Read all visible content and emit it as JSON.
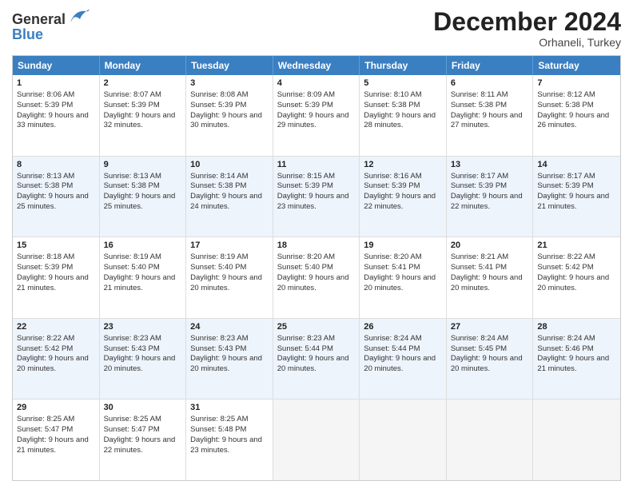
{
  "header": {
    "logo_line1": "General",
    "logo_line2": "Blue",
    "month": "December 2024",
    "location": "Orhaneli, Turkey"
  },
  "days": [
    "Sunday",
    "Monday",
    "Tuesday",
    "Wednesday",
    "Thursday",
    "Friday",
    "Saturday"
  ],
  "weeks": [
    [
      {
        "num": "1",
        "sunrise": "8:06 AM",
        "sunset": "5:39 PM",
        "daylight": "9 hours and 33 minutes."
      },
      {
        "num": "2",
        "sunrise": "8:07 AM",
        "sunset": "5:39 PM",
        "daylight": "9 hours and 32 minutes."
      },
      {
        "num": "3",
        "sunrise": "8:08 AM",
        "sunset": "5:39 PM",
        "daylight": "9 hours and 30 minutes."
      },
      {
        "num": "4",
        "sunrise": "8:09 AM",
        "sunset": "5:39 PM",
        "daylight": "9 hours and 29 minutes."
      },
      {
        "num": "5",
        "sunrise": "8:10 AM",
        "sunset": "5:38 PM",
        "daylight": "9 hours and 28 minutes."
      },
      {
        "num": "6",
        "sunrise": "8:11 AM",
        "sunset": "5:38 PM",
        "daylight": "9 hours and 27 minutes."
      },
      {
        "num": "7",
        "sunrise": "8:12 AM",
        "sunset": "5:38 PM",
        "daylight": "9 hours and 26 minutes."
      }
    ],
    [
      {
        "num": "8",
        "sunrise": "8:13 AM",
        "sunset": "5:38 PM",
        "daylight": "9 hours and 25 minutes."
      },
      {
        "num": "9",
        "sunrise": "8:13 AM",
        "sunset": "5:38 PM",
        "daylight": "9 hours and 25 minutes."
      },
      {
        "num": "10",
        "sunrise": "8:14 AM",
        "sunset": "5:38 PM",
        "daylight": "9 hours and 24 minutes."
      },
      {
        "num": "11",
        "sunrise": "8:15 AM",
        "sunset": "5:39 PM",
        "daylight": "9 hours and 23 minutes."
      },
      {
        "num": "12",
        "sunrise": "8:16 AM",
        "sunset": "5:39 PM",
        "daylight": "9 hours and 22 minutes."
      },
      {
        "num": "13",
        "sunrise": "8:17 AM",
        "sunset": "5:39 PM",
        "daylight": "9 hours and 22 minutes."
      },
      {
        "num": "14",
        "sunrise": "8:17 AM",
        "sunset": "5:39 PM",
        "daylight": "9 hours and 21 minutes."
      }
    ],
    [
      {
        "num": "15",
        "sunrise": "8:18 AM",
        "sunset": "5:39 PM",
        "daylight": "9 hours and 21 minutes."
      },
      {
        "num": "16",
        "sunrise": "8:19 AM",
        "sunset": "5:40 PM",
        "daylight": "9 hours and 21 minutes."
      },
      {
        "num": "17",
        "sunrise": "8:19 AM",
        "sunset": "5:40 PM",
        "daylight": "9 hours and 20 minutes."
      },
      {
        "num": "18",
        "sunrise": "8:20 AM",
        "sunset": "5:40 PM",
        "daylight": "9 hours and 20 minutes."
      },
      {
        "num": "19",
        "sunrise": "8:20 AM",
        "sunset": "5:41 PM",
        "daylight": "9 hours and 20 minutes."
      },
      {
        "num": "20",
        "sunrise": "8:21 AM",
        "sunset": "5:41 PM",
        "daylight": "9 hours and 20 minutes."
      },
      {
        "num": "21",
        "sunrise": "8:22 AM",
        "sunset": "5:42 PM",
        "daylight": "9 hours and 20 minutes."
      }
    ],
    [
      {
        "num": "22",
        "sunrise": "8:22 AM",
        "sunset": "5:42 PM",
        "daylight": "9 hours and 20 minutes."
      },
      {
        "num": "23",
        "sunrise": "8:23 AM",
        "sunset": "5:43 PM",
        "daylight": "9 hours and 20 minutes."
      },
      {
        "num": "24",
        "sunrise": "8:23 AM",
        "sunset": "5:43 PM",
        "daylight": "9 hours and 20 minutes."
      },
      {
        "num": "25",
        "sunrise": "8:23 AM",
        "sunset": "5:44 PM",
        "daylight": "9 hours and 20 minutes."
      },
      {
        "num": "26",
        "sunrise": "8:24 AM",
        "sunset": "5:44 PM",
        "daylight": "9 hours and 20 minutes."
      },
      {
        "num": "27",
        "sunrise": "8:24 AM",
        "sunset": "5:45 PM",
        "daylight": "9 hours and 20 minutes."
      },
      {
        "num": "28",
        "sunrise": "8:24 AM",
        "sunset": "5:46 PM",
        "daylight": "9 hours and 21 minutes."
      }
    ],
    [
      {
        "num": "29",
        "sunrise": "8:25 AM",
        "sunset": "5:47 PM",
        "daylight": "9 hours and 21 minutes."
      },
      {
        "num": "30",
        "sunrise": "8:25 AM",
        "sunset": "5:47 PM",
        "daylight": "9 hours and 22 minutes."
      },
      {
        "num": "31",
        "sunrise": "8:25 AM",
        "sunset": "5:48 PM",
        "daylight": "9 hours and 23 minutes."
      },
      null,
      null,
      null,
      null
    ]
  ],
  "labels": {
    "sunrise": "Sunrise:",
    "sunset": "Sunset:",
    "daylight": "Daylight:"
  }
}
